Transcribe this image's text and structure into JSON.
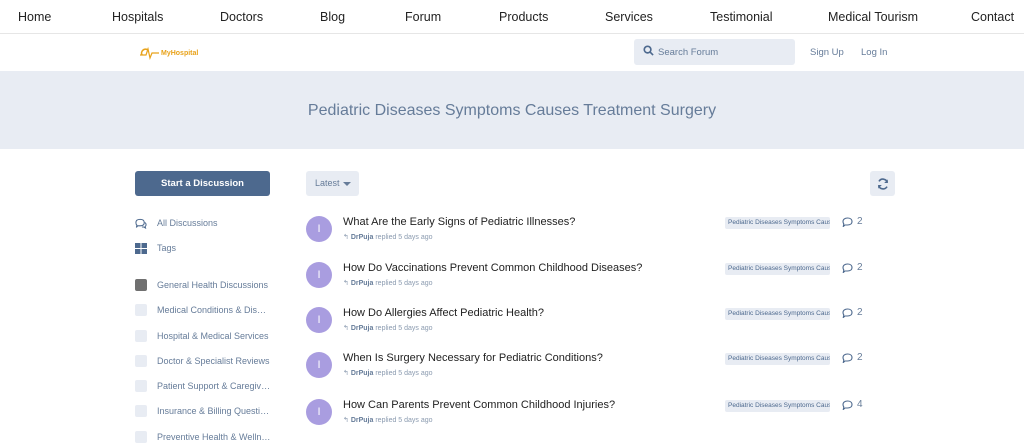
{
  "top_nav": [
    "Home",
    "Hospitals",
    "Doctors",
    "Blog",
    "Forum",
    "Products",
    "Services",
    "Testimonial",
    "Medical Tourism",
    "Contact"
  ],
  "logo": {
    "text": "MyHospital",
    "color": "#e8a21a"
  },
  "search": {
    "placeholder": "Search Forum"
  },
  "auth": {
    "signup": "Sign Up",
    "login": "Log In"
  },
  "hero": {
    "title": "Pediatric Diseases Symptoms Causes Treatment Surgery"
  },
  "sidebar": {
    "start_button": "Start a Discussion",
    "nav": [
      {
        "label": "All Discussions",
        "icon": "comments-icon"
      },
      {
        "label": "Tags",
        "icon": "tags-grid-icon"
      }
    ],
    "tags": [
      "General Health Discussions",
      "Medical Conditions & Diseases",
      "Hospital & Medical Services",
      "Doctor & Specialist Reviews",
      "Patient Support & Caregiving",
      "Insurance & Billing Questions",
      "Preventive Health & Wellness"
    ]
  },
  "toolbar": {
    "sort_label": "Latest"
  },
  "discussions": [
    {
      "avatar": "I",
      "title": "What Are the Early Signs of Pediatric Illnesses?",
      "author": "DrPuja",
      "time": "replied 5 days ago",
      "tag": "Pediatric Diseases Symptoms Causes Treatment Surgery",
      "replies": "2"
    },
    {
      "avatar": "I",
      "title": "How Do Vaccinations Prevent Common Childhood Diseases?",
      "author": "DrPuja",
      "time": "replied 5 days ago",
      "tag": "Pediatric Diseases Symptoms Causes Treatment Surgery",
      "replies": "2"
    },
    {
      "avatar": "I",
      "title": "How Do Allergies Affect Pediatric Health?",
      "author": "DrPuja",
      "time": "replied 5 days ago",
      "tag": "Pediatric Diseases Symptoms Causes Treatment Surgery",
      "replies": "2"
    },
    {
      "avatar": "I",
      "title": "When Is Surgery Necessary for Pediatric Conditions?",
      "author": "DrPuja",
      "time": "replied 5 days ago",
      "tag": "Pediatric Diseases Symptoms Causes Treatment Surgery",
      "replies": "2"
    },
    {
      "avatar": "I",
      "title": "How Can Parents Prevent Common Childhood Injuries?",
      "author": "DrPuja",
      "time": "replied 5 days ago",
      "tag": "Pediatric Diseases Symptoms Causes Treatment Surgery",
      "replies": "4"
    }
  ],
  "colors": {
    "accent": "#4d698e",
    "muted": "#667c99",
    "panel": "#e8ecf3",
    "avatar": "#a99de0"
  }
}
